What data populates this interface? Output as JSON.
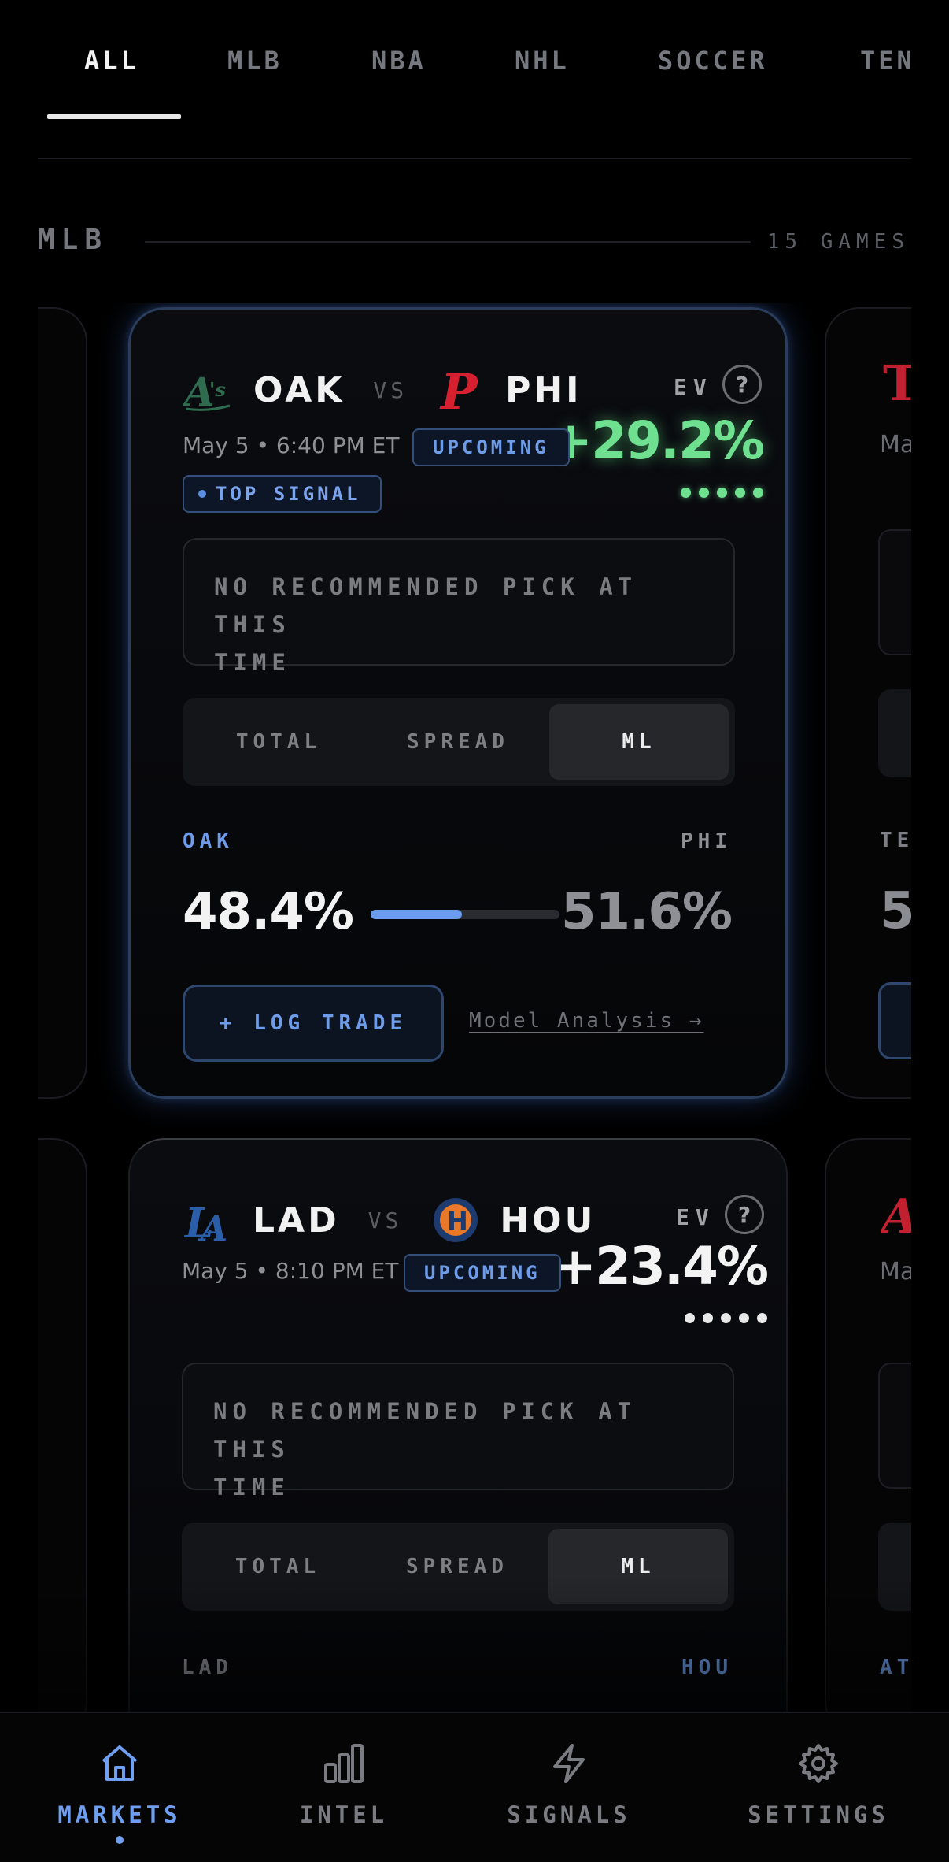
{
  "tabs": [
    {
      "label": "ALL",
      "active": true
    },
    {
      "label": "MLB"
    },
    {
      "label": "NBA"
    },
    {
      "label": "NHL"
    },
    {
      "label": "SOCCER"
    },
    {
      "label": "TEN"
    }
  ],
  "section": {
    "title": "MLB",
    "count": "15 GAMES"
  },
  "games": [
    {
      "away": "OAK",
      "home": "PHI",
      "vs": "VS",
      "ev_label": "EV",
      "ev_help": "?",
      "ev_value": "+29.2%",
      "ev_color": "#6fe08f",
      "signal_strength": 5,
      "time": "May 5 • 6:40 PM ET",
      "status": "UPCOMING",
      "signal_badge": "TOP SIGNAL",
      "no_pick_line1": "NO RECOMMENDED PICK AT THIS",
      "no_pick_line2": "TIME",
      "markets": [
        "TOTAL",
        "SPREAD",
        "ML"
      ],
      "active_market": "ML",
      "split": {
        "away_label": "OAK",
        "home_label": "PHI",
        "away_pct": "48.4%",
        "home_pct": "51.6%",
        "away_fraction": 0.484
      },
      "log_trade": "+ LOG TRADE",
      "model_link": "Model Analysis →"
    },
    {
      "away": "LAD",
      "home": "HOU",
      "vs": "VS",
      "ev_label": "EV",
      "ev_help": "?",
      "ev_value": "+23.4%",
      "ev_color": "#f3f3f3",
      "signal_strength": 5,
      "time": "May 5 • 8:10 PM ET",
      "status": "UPCOMING",
      "no_pick_line1": "NO RECOMMENDED PICK AT THIS",
      "no_pick_line2": "TIME",
      "markets": [
        "TOTAL",
        "SPREAD",
        "ML"
      ],
      "active_market": "ML",
      "split": {
        "away_label": "LAD",
        "home_label": "HOU"
      }
    }
  ],
  "peek": {
    "time_fragment": "Ma",
    "split_label_1": "TE",
    "pct_fragment": "5",
    "split_label_2": "AT"
  },
  "nav": [
    {
      "label": "MARKETS",
      "icon": "home-icon",
      "active": true
    },
    {
      "label": "INTEL",
      "icon": "bar-chart-icon"
    },
    {
      "label": "SIGNALS",
      "icon": "lightning-icon"
    },
    {
      "label": "SETTINGS",
      "icon": "gear-icon"
    }
  ],
  "colors": {
    "accent": "#6f9ff0",
    "ev_green": "#6fe08f",
    "background": "#000000"
  }
}
